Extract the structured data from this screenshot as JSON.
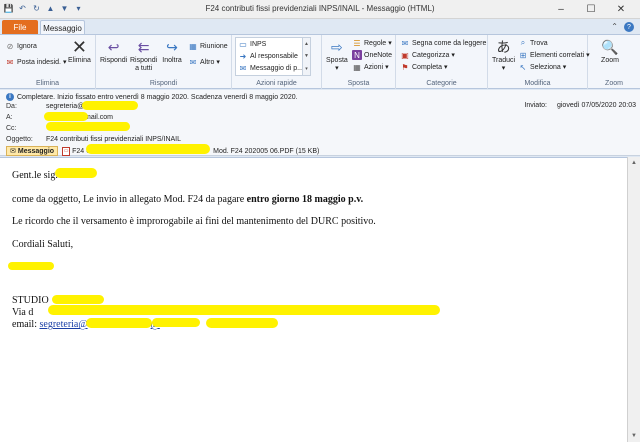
{
  "window": {
    "title": "F24 contributi fissi previdenziali INPS/INAIL  -  Messaggio (HTML)",
    "qat_icons": [
      "save-icon",
      "undo-icon",
      "redo-icon",
      "up-arrow-icon",
      "down-arrow-icon",
      "customize-icon"
    ],
    "controls": {
      "minimize": "–",
      "maximize": "☐",
      "close": "✕"
    }
  },
  "tabs": {
    "file": "File",
    "message": "Messaggio",
    "collapse": "⌃",
    "help": "?"
  },
  "ribbon": {
    "elimina": {
      "label": "Elimina",
      "ignora": "Ignora",
      "posta_indesid": "Posta indesid.",
      "elimina_btn": "Elimina"
    },
    "rispondi": {
      "label": "Rispondi",
      "rispondi": "Rispondi",
      "rispondi_tutti_1": "Rispondi",
      "rispondi_tutti_2": "a tutti",
      "inoltra": "Inoltra",
      "riunione": "Riunione",
      "altro": "Altro"
    },
    "azioni_rapide": {
      "label": "Azioni rapide",
      "items": [
        "INPS",
        "Al responsabile",
        "Messaggio di p..."
      ]
    },
    "sposta": {
      "label": "Sposta",
      "sposta": "Sposta",
      "regole": "Regole",
      "onenote": "OneNote",
      "azioni": "Azioni"
    },
    "categorie": {
      "label": "Categorie",
      "segna": "Segna come da leggere",
      "categorizza": "Categorizza",
      "completa": "Completa"
    },
    "modifica": {
      "label": "Modifica",
      "traduci": "Traduci",
      "trova": "Trova",
      "elementi": "Elementi correlati",
      "seleziona": "Seleziona"
    },
    "zoom": {
      "label": "Zoom",
      "zoom": "Zoom"
    }
  },
  "header": {
    "info": "Completare.  Inizio fissato entro venerdì 8 maggio 2020.  Scadenza venerdì 8 maggio 2020.",
    "sent_label": "Inviato:",
    "sent_value": "giovedì 07/05/2020 20:03",
    "da_label": "Da:",
    "da_value": "segreteria@",
    "a_label": "A:",
    "a_value": "@gmail.com",
    "cc_label": "Cc:",
    "cc_value": "",
    "oggetto_label": "Oggetto:",
    "oggetto_value": "F24 contributi fissi previdenziali INPS/INAIL",
    "messaggio_btn": "Messaggio",
    "attachment_prefix": "F24 C",
    "attachment_suffix": "Mod. F24 202005 06.PDF (15 KB)"
  },
  "body": {
    "greeting": "Gent.le sig.",
    "line1_pre": "come da oggetto, Le invio in allegato Mod. F24 da pagare ",
    "line1_bold": "entro giorno 18 maggio p.v.",
    "line2": "Le ricordo che il versamento è improrogabile ai fini del mantenimento del DURC positivo.",
    "closing": "Cordiali Saluti,",
    "studio": "STUDIO",
    "via": "Via d",
    "email_label": "email:",
    "email_link1": "segreteria@",
    "email_link2": "@"
  }
}
